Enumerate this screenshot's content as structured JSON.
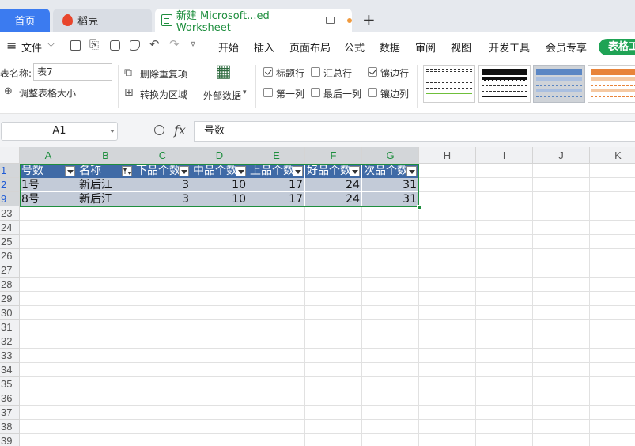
{
  "tabs": {
    "home": "首页",
    "docer": "稻壳",
    "workbook": "新建 Microsoft...ed Worksheet",
    "new_tab": "+"
  },
  "menu": {
    "file": "文件",
    "items": [
      "开始",
      "插入",
      "页面布局",
      "公式",
      "数据",
      "审阅",
      "视图",
      "开发工具",
      "会员专享"
    ],
    "table_tools": "表格工"
  },
  "ribbon": {
    "table_name_label": "表名称:",
    "table_name_value": "表7",
    "resize_table": "调整表格大小",
    "remove_duplicates": "删除重复项",
    "convert_to_range": "转换为区域",
    "external_data": "外部数据",
    "options": [
      {
        "label": "标题行",
        "checked": true
      },
      {
        "label": "汇总行",
        "checked": false
      },
      {
        "label": "镶边行",
        "checked": true
      },
      {
        "label": "第一列",
        "checked": false
      },
      {
        "label": "最后一列",
        "checked": false
      },
      {
        "label": "镶边列",
        "checked": false
      }
    ]
  },
  "formula": {
    "cell_ref": "A1",
    "fx": "fx",
    "content": "号数"
  },
  "columns": [
    "A",
    "B",
    "C",
    "D",
    "E",
    "F",
    "G",
    "H",
    "I",
    "J",
    "K"
  ],
  "rows": [
    "1",
    "2",
    "9",
    "23",
    "24",
    "25",
    "26",
    "27",
    "28",
    "29",
    "30",
    "31",
    "32",
    "33",
    "34",
    "35",
    "36",
    "37",
    "38",
    "39"
  ],
  "table": {
    "headers": [
      "号数",
      "名称",
      "下品个数",
      "中品个数",
      "上品个数",
      "好品个数",
      "次品个数"
    ],
    "data": [
      [
        "1号",
        "新后江",
        "3",
        "10",
        "17",
        "24",
        "31"
      ],
      [
        "8号",
        "新后江",
        "3",
        "10",
        "17",
        "24",
        "31"
      ]
    ]
  },
  "colors": {
    "accent": "#1e8e3e",
    "header_fill": "#3f6aa6",
    "band_fill": "#c3cbd8",
    "home_tab": "#3b7bf0"
  }
}
